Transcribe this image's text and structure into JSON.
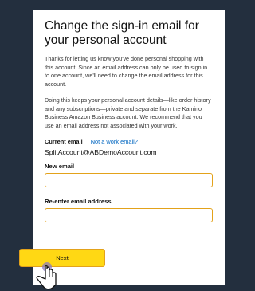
{
  "page": {
    "title": "Change the sign-in email for your personal account",
    "paragraph1": "Thanks for letting us know you've done personal shopping with this account. Since an email address can only be used to sign in to one account, we'll need to change the email address for this account.",
    "paragraph2": "Doing this keeps your personal account details—like order history and any subscriptions—private and separate from the Kamino Business Amazon Business account. We recommend that you use an email address not associated with your work.",
    "current_email_label": "Current email",
    "work_email_link": "Not a work email?",
    "current_email_value": "SplitAccount@ABDemoAccount.com",
    "new_email_label": "New email",
    "new_email_value": "",
    "reenter_label": "Re-enter email address",
    "reenter_value": "",
    "next_button": "Next"
  },
  "colors": {
    "background": "#232f3e",
    "input_border": "#e3a21a",
    "button_fill": "#ffd814",
    "link": "#0066c0"
  },
  "icons": {
    "cursor": "hand-pointer-icon"
  }
}
